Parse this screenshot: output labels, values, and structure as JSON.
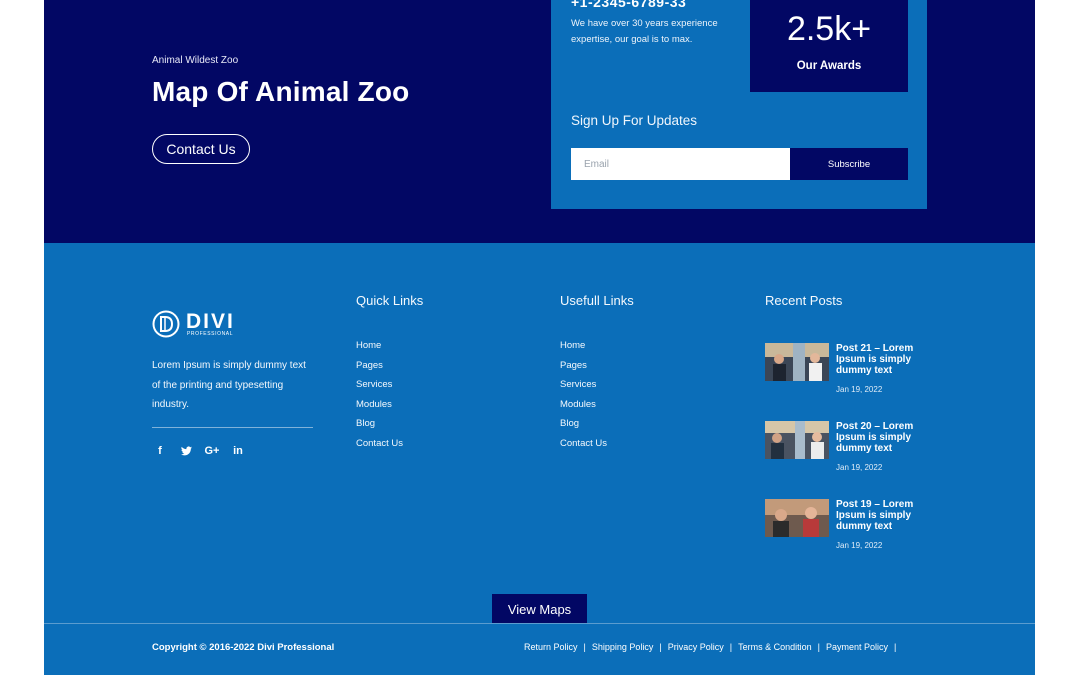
{
  "hero": {
    "eyebrow": "Animal Wildest Zoo",
    "title": "Map Of Animal Zoo",
    "contact_button": "Contact Us"
  },
  "info": {
    "phone": "+1-2345-6789-33",
    "experience_text": "We have over 30 years experience expertise, our goal is to max.",
    "awards_value": "2.5k+",
    "awards_label": "Our Awards",
    "signup_title": "Sign Up For Updates",
    "email_placeholder": "Email",
    "subscribe_label": "Subscribe"
  },
  "brand": {
    "name": "DIVI",
    "tagline": "PROFESSIONAL",
    "about": "Lorem Ipsum is simply dummy text of the printing and typesetting industry."
  },
  "socials": [
    {
      "icon": "facebook-icon",
      "glyph": "f"
    },
    {
      "icon": "twitter-icon",
      "glyph": "🐦"
    },
    {
      "icon": "google-plus-icon",
      "glyph": "G+"
    },
    {
      "icon": "linkedin-icon",
      "glyph": "in"
    }
  ],
  "quick_links": {
    "title": "Quick Links",
    "items": [
      "Home",
      "Pages",
      "Services",
      "Modules",
      "Blog",
      "Contact Us"
    ]
  },
  "useful_links": {
    "title": "Usefull Links",
    "items": [
      "Home",
      "Pages",
      "Services",
      "Modules",
      "Blog",
      "Contact Us"
    ]
  },
  "recent_posts": {
    "title": "Recent Posts",
    "posts": [
      {
        "title": "Post 21 – Lorem Ipsum is simply dummy text",
        "date": "Jan 19, 2022"
      },
      {
        "title": "Post 20 – Lorem Ipsum is simply dummy text",
        "date": "Jan 19, 2022"
      },
      {
        "title": "Post 19 – Lorem Ipsum is simply dummy text",
        "date": "Jan 19, 2022"
      }
    ]
  },
  "view_maps_label": "View Maps",
  "footer": {
    "copyright": "Copyright © 2016-2022 Divi Professional",
    "policies": [
      "Return Policy",
      "Shipping Policy",
      "Privacy Policy",
      "Terms & Condition",
      "Payment Policy"
    ]
  },
  "colors": {
    "navy": "#020764",
    "blue": "#0b6eb9",
    "white": "#ffffff"
  }
}
